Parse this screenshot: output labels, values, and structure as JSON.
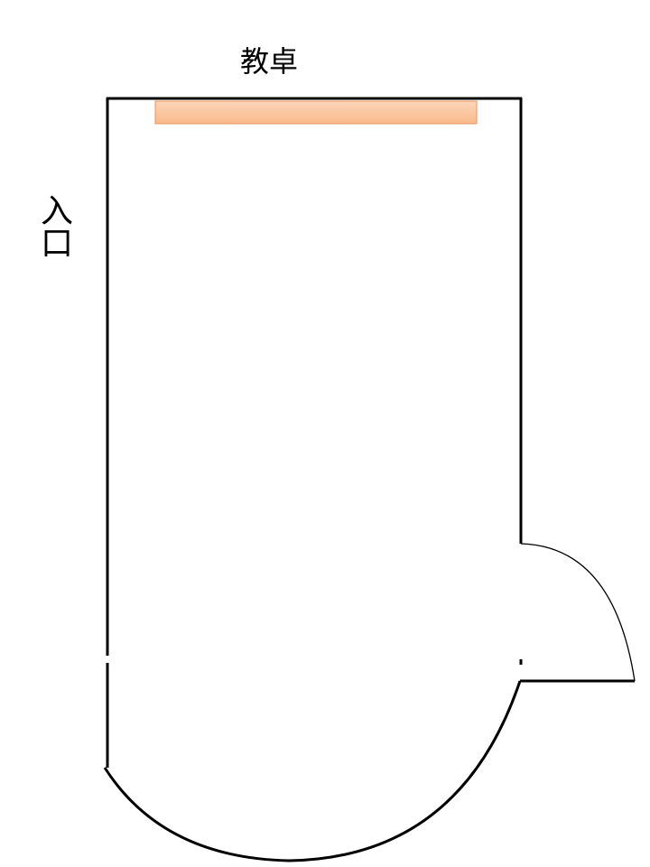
{
  "labels": {
    "podium": "教卓",
    "entrance": "入口"
  },
  "colors": {
    "wall": "#000000",
    "podium_fill": "#fbc8a4",
    "podium_stroke": "#e8935c",
    "background": "#ffffff"
  }
}
